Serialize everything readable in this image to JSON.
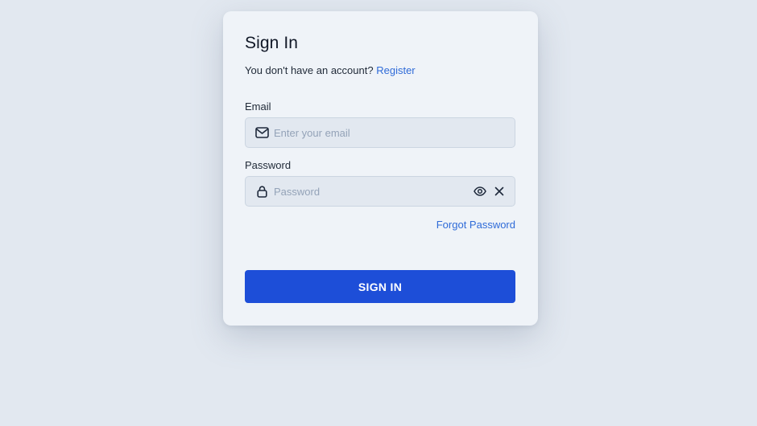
{
  "signin": {
    "title": "Sign In",
    "no_account_text": "You don't have an account?",
    "register_link": "Register",
    "email_label": "Email",
    "email_placeholder": "Enter your email",
    "email_icon": "mail-icon",
    "password_label": "Password",
    "password_placeholder": "Password",
    "password_icon": "lock-icon",
    "toggle_visibility_icon": "eye-icon",
    "clear_icon": "close-icon",
    "forgot_link": "Forgot Password",
    "submit_label": "SIGN IN"
  },
  "colors": {
    "page_background": "#e2e8f0",
    "card_background": "#eff3f8",
    "input_background": "#e2e8f0",
    "link": "#2f6bd8",
    "primary_button": "#1d4ed8"
  }
}
